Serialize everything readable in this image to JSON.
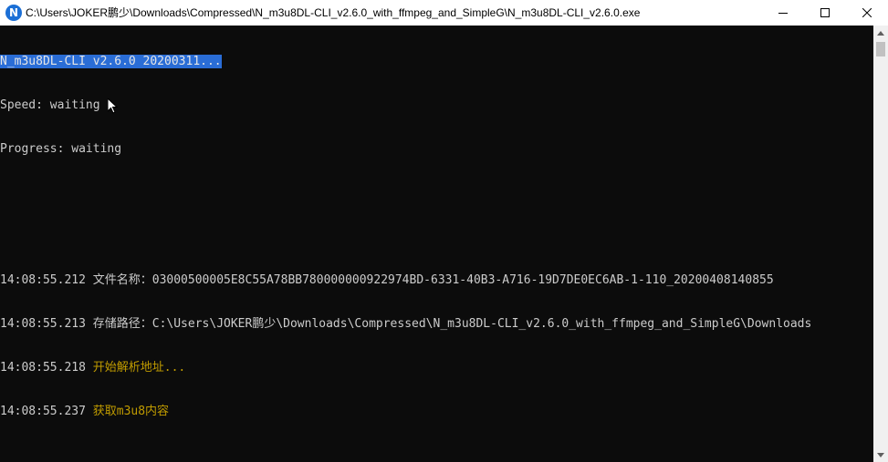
{
  "window": {
    "title": "C:\\Users\\JOKER鹏少\\Downloads\\Compressed\\N_m3u8DL-CLI_v2.6.0_with_ffmpeg_and_SimpleG\\N_m3u8DL-CLI_v2.6.0.exe",
    "icon_letter": "N",
    "icon_name": "app-n-icon"
  },
  "console": {
    "header": "N_m3u8DL-CLI v2.6.0 20200311...",
    "speed": "Speed: waiting",
    "progress": "Progress: waiting",
    "logs": [
      {
        "time": "14:08:55.212",
        "text": "文件名称：03000500005E8C55A78BB780000000922974BD-6331-40B3-A716-19D7DE0EC6AB-1-110_20200408140855"
      },
      {
        "time": "14:08:55.213",
        "text": "存储路径：C:\\Users\\JOKER鹏少\\Downloads\\Compressed\\N_m3u8DL-CLI_v2.6.0_with_ffmpeg_and_SimpleG\\Downloads"
      },
      {
        "time": "14:08:55.218",
        "text": "开始解析地址..."
      },
      {
        "time": "14:08:55.237",
        "text": "获取m3u8内容"
      }
    ]
  },
  "colors": {
    "background": "#0c0c0c",
    "text": "#cccccc",
    "highlight": "#2a6dd6",
    "warning_yellow": "#c19c00"
  }
}
